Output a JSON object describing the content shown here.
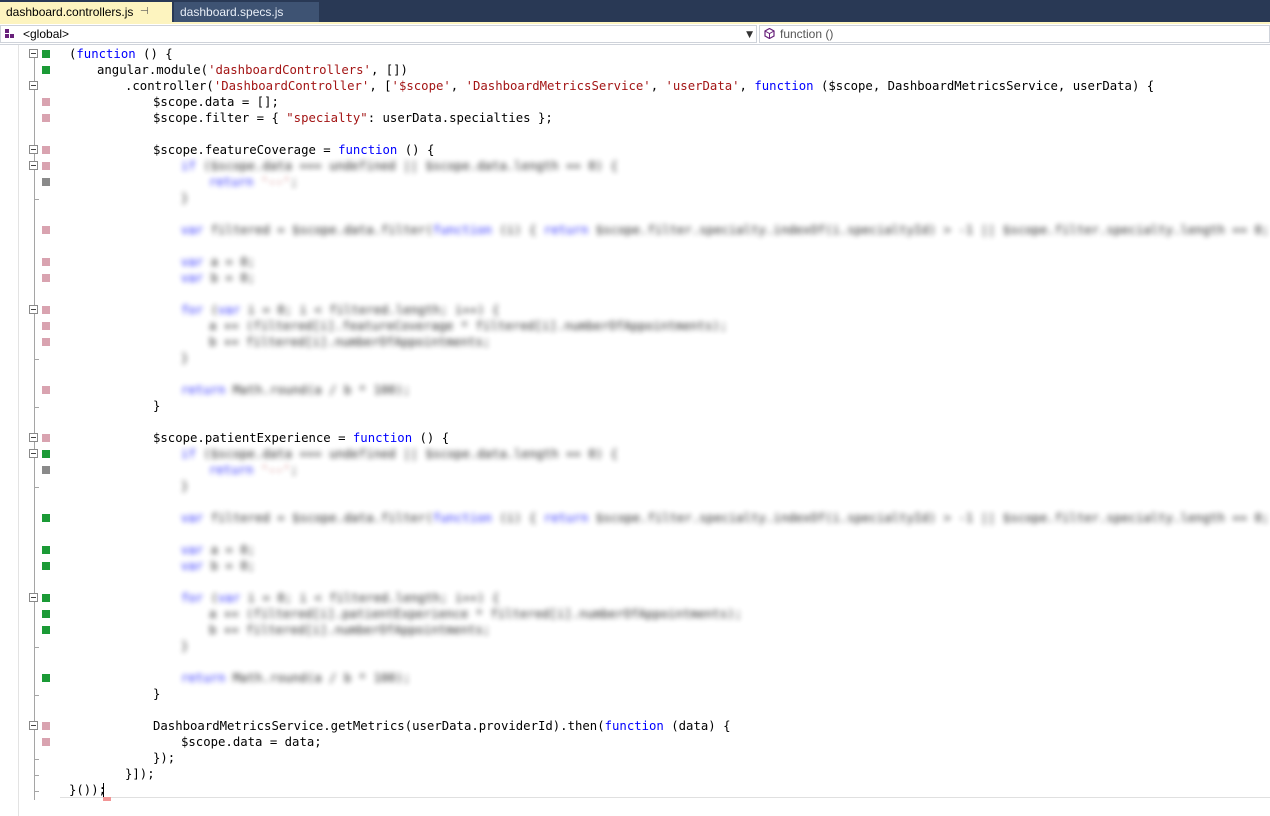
{
  "tabs": [
    {
      "label": "dashboard.controllers.js",
      "active": true,
      "pin_icon": "pin-icon"
    },
    {
      "label": "dashboard.specs.js",
      "active": false
    }
  ],
  "navbar": {
    "scope": "<global>",
    "member": "function ()"
  },
  "colors": {
    "tab_active": "#fdf4bf",
    "tab_strip": "#293955",
    "keyword": "#0000ff",
    "string": "#a31515",
    "saved_change": "#1b9a36",
    "unsaved_change": "#d9a3b0"
  },
  "lines": [
    {
      "fold": "open",
      "mark": "green",
      "indent": 0,
      "blur": false,
      "tokens": [
        [
          "p",
          "("
        ],
        [
          "k",
          "function"
        ],
        [
          "p",
          " () {"
        ]
      ]
    },
    {
      "fold": "none",
      "mark": "green",
      "indent": 1,
      "blur": false,
      "tokens": [
        [
          "p",
          "angular.module("
        ],
        [
          "s",
          "'dashboardControllers'"
        ],
        [
          "p",
          ", [])"
        ]
      ]
    },
    {
      "fold": "open",
      "mark": "",
      "indent": 2,
      "blur": false,
      "tokens": [
        [
          "p",
          ".controller("
        ],
        [
          "s",
          "'DashboardController'"
        ],
        [
          "p",
          ", ["
        ],
        [
          "s",
          "'$scope'"
        ],
        [
          "p",
          ", "
        ],
        [
          "s",
          "'DashboardMetricsService'"
        ],
        [
          "p",
          ", "
        ],
        [
          "s",
          "'userData'"
        ],
        [
          "p",
          ", "
        ],
        [
          "k",
          "function"
        ],
        [
          "p",
          " ($scope, DashboardMetricsService, userData) {"
        ]
      ]
    },
    {
      "fold": "none",
      "mark": "pink",
      "indent": 3,
      "blur": false,
      "tokens": [
        [
          "p",
          "$scope.data = [];"
        ]
      ]
    },
    {
      "fold": "none",
      "mark": "pink",
      "indent": 3,
      "blur": false,
      "tokens": [
        [
          "p",
          "$scope.filter = { "
        ],
        [
          "s",
          "\"specialty\""
        ],
        [
          "p",
          ": userData.specialties };"
        ]
      ]
    },
    {
      "fold": "none",
      "mark": "",
      "indent": 0,
      "blur": false,
      "tokens": []
    },
    {
      "fold": "open",
      "mark": "pink",
      "indent": 3,
      "blur": false,
      "tokens": [
        [
          "p",
          "$scope.featureCoverage = "
        ],
        [
          "k",
          "function"
        ],
        [
          "p",
          " () {"
        ]
      ]
    },
    {
      "fold": "open",
      "mark": "pink",
      "indent": 4,
      "blur": true,
      "tokens": [
        [
          "k",
          "if"
        ],
        [
          "p",
          " ($scope.data === undefined || $scope.data.length == 0) {"
        ]
      ]
    },
    {
      "fold": "none",
      "mark": "gray",
      "indent": 5,
      "blur": true,
      "tokens": [
        [
          "k",
          "return"
        ],
        [
          "p",
          " "
        ],
        [
          "s",
          "'--'"
        ],
        [
          "p",
          ";"
        ]
      ]
    },
    {
      "fold": "end",
      "mark": "",
      "indent": 4,
      "blur": true,
      "tokens": [
        [
          "p",
          "}"
        ]
      ]
    },
    {
      "fold": "none",
      "mark": "",
      "indent": 0,
      "blur": false,
      "tokens": []
    },
    {
      "fold": "none",
      "mark": "pink",
      "indent": 4,
      "blur": true,
      "tokens": [
        [
          "k",
          "var"
        ],
        [
          "p",
          " filtered = $scope.data.filter("
        ],
        [
          "k",
          "function"
        ],
        [
          "p",
          " (i) { "
        ],
        [
          "k",
          "return"
        ],
        [
          "p",
          " $scope.filter.specialty.indexOf(i.specialtyId) > -1 || $scope.filter.specialty.length == 0; });"
        ]
      ]
    },
    {
      "fold": "none",
      "mark": "",
      "indent": 0,
      "blur": false,
      "tokens": []
    },
    {
      "fold": "none",
      "mark": "pink",
      "indent": 4,
      "blur": true,
      "tokens": [
        [
          "k",
          "var"
        ],
        [
          "p",
          " a = 0;"
        ]
      ]
    },
    {
      "fold": "none",
      "mark": "pink",
      "indent": 4,
      "blur": true,
      "tokens": [
        [
          "k",
          "var"
        ],
        [
          "p",
          " b = 0;"
        ]
      ]
    },
    {
      "fold": "none",
      "mark": "",
      "indent": 0,
      "blur": false,
      "tokens": []
    },
    {
      "fold": "open",
      "mark": "pink",
      "indent": 4,
      "blur": true,
      "tokens": [
        [
          "k",
          "for"
        ],
        [
          "p",
          " ("
        ],
        [
          "k",
          "var"
        ],
        [
          "p",
          " i = 0; i < filtered.length; i++) {"
        ]
      ]
    },
    {
      "fold": "none",
      "mark": "pink",
      "indent": 5,
      "blur": true,
      "tokens": [
        [
          "p",
          "a += (filtered[i].featureCoverage * filtered[i].numberOfAppointments);"
        ]
      ]
    },
    {
      "fold": "none",
      "mark": "pink",
      "indent": 5,
      "blur": true,
      "tokens": [
        [
          "p",
          "b += filtered[i].numberOfAppointments;"
        ]
      ]
    },
    {
      "fold": "end",
      "mark": "",
      "indent": 4,
      "blur": true,
      "tokens": [
        [
          "p",
          "}"
        ]
      ]
    },
    {
      "fold": "none",
      "mark": "",
      "indent": 0,
      "blur": false,
      "tokens": []
    },
    {
      "fold": "none",
      "mark": "pink",
      "indent": 4,
      "blur": true,
      "tokens": [
        [
          "k",
          "return"
        ],
        [
          "p",
          " Math.round(a / b * 100);"
        ]
      ]
    },
    {
      "fold": "end",
      "mark": "",
      "indent": 3,
      "blur": false,
      "tokens": [
        [
          "p",
          "}"
        ]
      ]
    },
    {
      "fold": "none",
      "mark": "",
      "indent": 0,
      "blur": false,
      "tokens": []
    },
    {
      "fold": "open",
      "mark": "pink",
      "indent": 3,
      "blur": false,
      "tokens": [
        [
          "p",
          "$scope.patientExperience = "
        ],
        [
          "k",
          "function"
        ],
        [
          "p",
          " () {"
        ]
      ]
    },
    {
      "fold": "open",
      "mark": "green",
      "indent": 4,
      "blur": true,
      "tokens": [
        [
          "k",
          "if"
        ],
        [
          "p",
          " ($scope.data === undefined || $scope.data.length == 0) {"
        ]
      ]
    },
    {
      "fold": "none",
      "mark": "gray",
      "indent": 5,
      "blur": true,
      "tokens": [
        [
          "k",
          "return"
        ],
        [
          "p",
          " "
        ],
        [
          "s",
          "'--'"
        ],
        [
          "p",
          ";"
        ]
      ]
    },
    {
      "fold": "end",
      "mark": "",
      "indent": 4,
      "blur": true,
      "tokens": [
        [
          "p",
          "}"
        ]
      ]
    },
    {
      "fold": "none",
      "mark": "",
      "indent": 0,
      "blur": false,
      "tokens": []
    },
    {
      "fold": "none",
      "mark": "green",
      "indent": 4,
      "blur": true,
      "tokens": [
        [
          "k",
          "var"
        ],
        [
          "p",
          " filtered = $scope.data.filter("
        ],
        [
          "k",
          "function"
        ],
        [
          "p",
          " (i) { "
        ],
        [
          "k",
          "return"
        ],
        [
          "p",
          " $scope.filter.specialty.indexOf(i.specialtyId) > -1 || $scope.filter.specialty.length == 0; });"
        ]
      ]
    },
    {
      "fold": "none",
      "mark": "",
      "indent": 0,
      "blur": false,
      "tokens": []
    },
    {
      "fold": "none",
      "mark": "green",
      "indent": 4,
      "blur": true,
      "tokens": [
        [
          "k",
          "var"
        ],
        [
          "p",
          " a = 0;"
        ]
      ]
    },
    {
      "fold": "none",
      "mark": "green",
      "indent": 4,
      "blur": true,
      "tokens": [
        [
          "k",
          "var"
        ],
        [
          "p",
          " b = 0;"
        ]
      ]
    },
    {
      "fold": "none",
      "mark": "",
      "indent": 0,
      "blur": false,
      "tokens": []
    },
    {
      "fold": "open",
      "mark": "green",
      "indent": 4,
      "blur": true,
      "tokens": [
        [
          "k",
          "for"
        ],
        [
          "p",
          " ("
        ],
        [
          "k",
          "var"
        ],
        [
          "p",
          " i = 0; i < filtered.length; i++) {"
        ]
      ]
    },
    {
      "fold": "none",
      "mark": "green",
      "indent": 5,
      "blur": true,
      "tokens": [
        [
          "p",
          "a += (filtered[i].patientExperience * filtered[i].numberOfAppointments);"
        ]
      ]
    },
    {
      "fold": "none",
      "mark": "green",
      "indent": 5,
      "blur": true,
      "tokens": [
        [
          "p",
          "b += filtered[i].numberOfAppointments;"
        ]
      ]
    },
    {
      "fold": "end",
      "mark": "",
      "indent": 4,
      "blur": true,
      "tokens": [
        [
          "p",
          "}"
        ]
      ]
    },
    {
      "fold": "none",
      "mark": "",
      "indent": 0,
      "blur": false,
      "tokens": []
    },
    {
      "fold": "none",
      "mark": "green",
      "indent": 4,
      "blur": true,
      "tokens": [
        [
          "k",
          "return"
        ],
        [
          "p",
          " Math.round(a / b * 100);"
        ]
      ]
    },
    {
      "fold": "end",
      "mark": "",
      "indent": 3,
      "blur": false,
      "tokens": [
        [
          "p",
          "}"
        ]
      ]
    },
    {
      "fold": "none",
      "mark": "",
      "indent": 0,
      "blur": false,
      "tokens": []
    },
    {
      "fold": "open",
      "mark": "pink",
      "indent": 3,
      "blur": false,
      "tokens": [
        [
          "p",
          "DashboardMetricsService.getMetrics(userData.providerId).then("
        ],
        [
          "k",
          "function"
        ],
        [
          "p",
          " (data) {"
        ]
      ]
    },
    {
      "fold": "none",
      "mark": "pink",
      "indent": 4,
      "blur": false,
      "tokens": [
        [
          "p",
          "$scope.data = data;"
        ]
      ]
    },
    {
      "fold": "end",
      "mark": "",
      "indent": 3,
      "blur": false,
      "tokens": [
        [
          "p",
          "});"
        ]
      ]
    },
    {
      "fold": "end",
      "mark": "",
      "indent": 2,
      "blur": false,
      "tokens": [
        [
          "p",
          "}]);"
        ]
      ]
    },
    {
      "fold": "end",
      "mark": "",
      "indent": 0,
      "blur": false,
      "tokens": [
        [
          "p",
          "}());"
        ]
      ]
    }
  ]
}
